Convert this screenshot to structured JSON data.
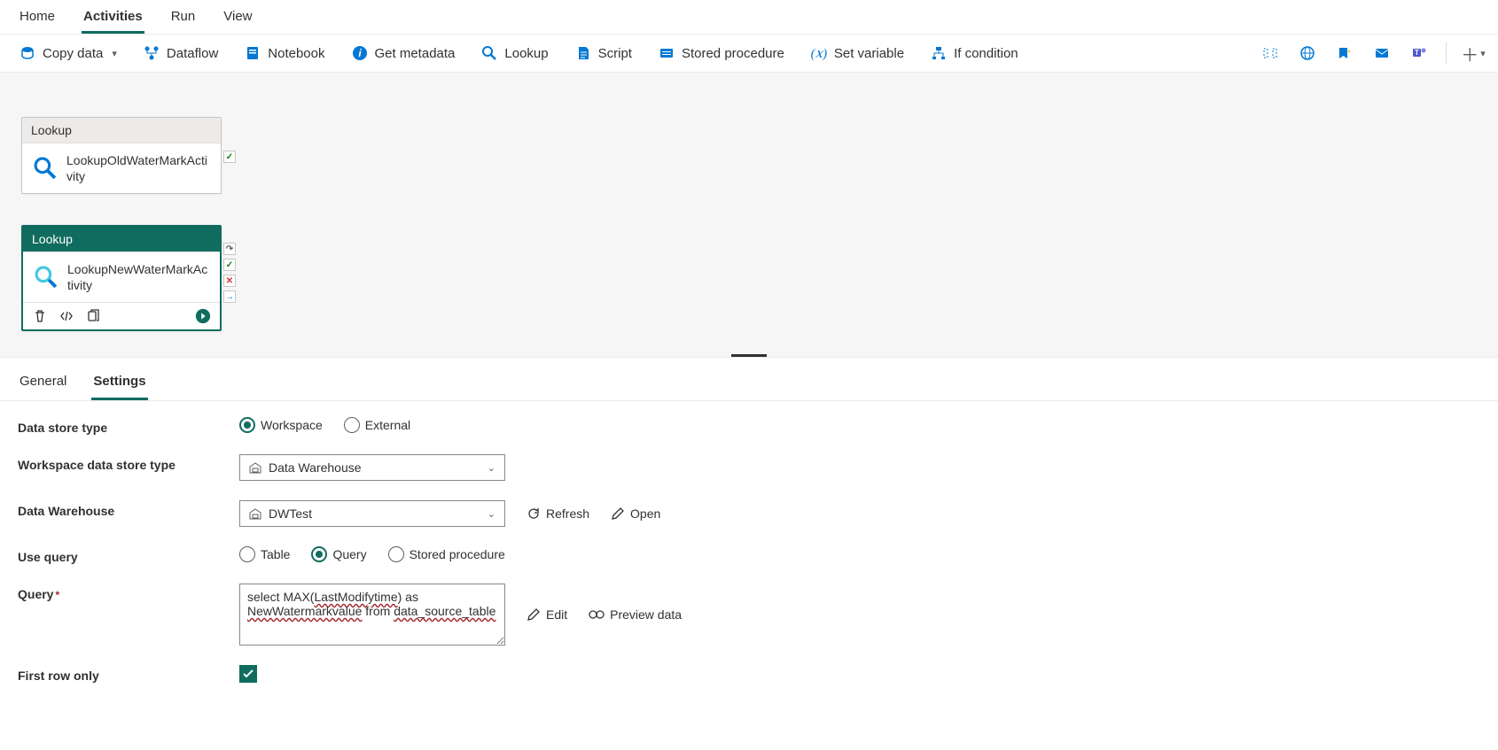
{
  "topTabs": {
    "home": "Home",
    "activities": "Activities",
    "run": "Run",
    "view": "View"
  },
  "toolbar": {
    "copyData": "Copy data",
    "dataflow": "Dataflow",
    "notebook": "Notebook",
    "getMetadata": "Get metadata",
    "lookup": "Lookup",
    "script": "Script",
    "storedProcedure": "Stored procedure",
    "setVariable": "Set variable",
    "ifCondition": "If condition"
  },
  "canvas": {
    "activity1": {
      "type": "Lookup",
      "name": "LookupOldWaterMarkActivity"
    },
    "activity2": {
      "type": "Lookup",
      "name": "LookupNewWaterMarkActivity"
    }
  },
  "bottomTabs": {
    "general": "General",
    "settings": "Settings"
  },
  "settings": {
    "labels": {
      "dataStoreType": "Data store type",
      "workspaceDataStoreType": "Workspace data store type",
      "dataWarehouse": "Data Warehouse",
      "useQuery": "Use query",
      "query": "Query",
      "firstRowOnly": "First row only"
    },
    "dataStoreType": {
      "workspace": "Workspace",
      "external": "External"
    },
    "workspaceDataStoreTypeValue": "Data Warehouse",
    "dataWarehouseValue": "DWTest",
    "actions": {
      "refresh": "Refresh",
      "open": "Open",
      "edit": "Edit",
      "previewData": "Preview data"
    },
    "useQuery": {
      "table": "Table",
      "query": "Query",
      "storedProcedure": "Stored procedure"
    },
    "queryValue": "select MAX(LastModifytime) as NewWatermarkvalue from data_source_table"
  }
}
